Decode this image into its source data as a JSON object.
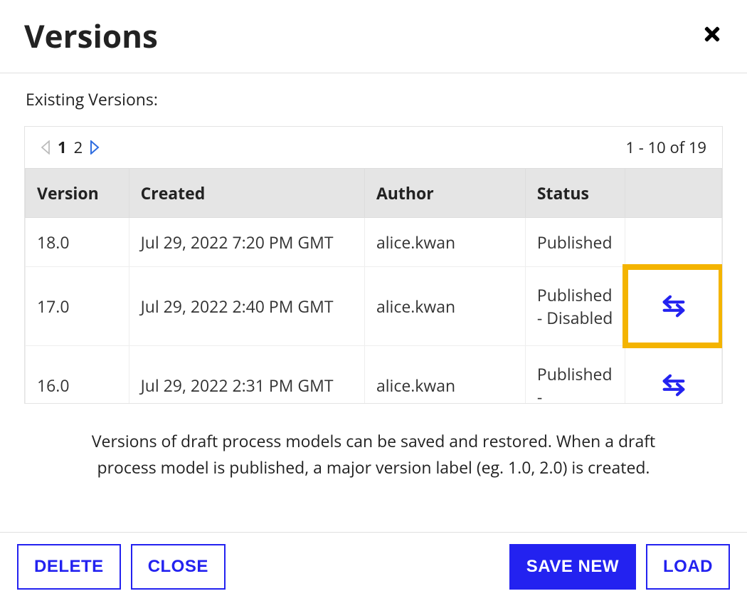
{
  "dialog": {
    "title": "Versions",
    "subtitle": "Existing Versions:",
    "hint": "Versions of draft process models can be saved and restored. When a draft process model is published, a major version label (eg. 1.0, 2.0) is created."
  },
  "pager": {
    "pages": [
      "1",
      "2"
    ],
    "range": "1 - 10 of 19"
  },
  "columns": {
    "version": "Version",
    "created": "Created",
    "author": "Author",
    "status": "Status"
  },
  "rows": [
    {
      "version": "18.0",
      "created": "Jul 29, 2022 7:20 PM GMT",
      "author": "alice.kwan",
      "status": "Published",
      "has_swap": false,
      "highlight": false
    },
    {
      "version": "17.0",
      "created": "Jul 29, 2022 2:40 PM GMT",
      "author": "alice.kwan",
      "status": "Published - Disabled",
      "has_swap": true,
      "highlight": true
    },
    {
      "version": "16.0",
      "created": "Jul 29, 2022 2:31 PM GMT",
      "author": "alice.kwan",
      "status": "Published -",
      "has_swap": true,
      "highlight": false
    }
  ],
  "buttons": {
    "delete": "DELETE",
    "close": "CLOSE",
    "save_new": "SAVE NEW",
    "load": "LOAD"
  },
  "colors": {
    "primary": "#2322f0",
    "highlight": "#f4b400"
  }
}
